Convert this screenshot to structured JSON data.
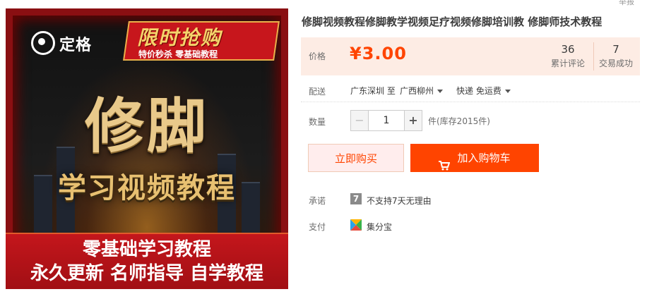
{
  "top_link": "举报",
  "product": {
    "title": "修脚视频教程修脚教学视频足疗视频修脚培训教 修脚师技术教程"
  },
  "banner": {
    "logo_text": "定格",
    "promo_title": "限时抢购",
    "promo_subtitle": "特价秒杀 零基础教程",
    "main_title": "修脚",
    "sub_title": "学习视频教程",
    "footer_line1": "零基础学习教程",
    "footer_line2": "永久更新 名师指导 自学教程",
    "colors": {
      "red": "#c4161c",
      "gold": "#e9c98a"
    }
  },
  "price": {
    "label": "价格",
    "value": "¥3.00",
    "color": "#ff4400"
  },
  "stats": [
    {
      "value": "36",
      "label": "累计评论"
    },
    {
      "value": "7",
      "label": "交易成功"
    }
  ],
  "shipping": {
    "label": "配送",
    "from": "广东深圳 至",
    "to": "广西柳州",
    "method": "快递 免运费"
  },
  "quantity": {
    "label": "数量",
    "value": "1",
    "minus": "−",
    "plus": "+",
    "stock": "件(库存2015件)"
  },
  "actions": {
    "buy_now": "立即购买",
    "add_to_cart": "加入购物车"
  },
  "promise": {
    "label": "承诺",
    "icon_text": "7",
    "text": "不支持7天无理由"
  },
  "payment": {
    "label": "支付",
    "method": "集分宝"
  }
}
